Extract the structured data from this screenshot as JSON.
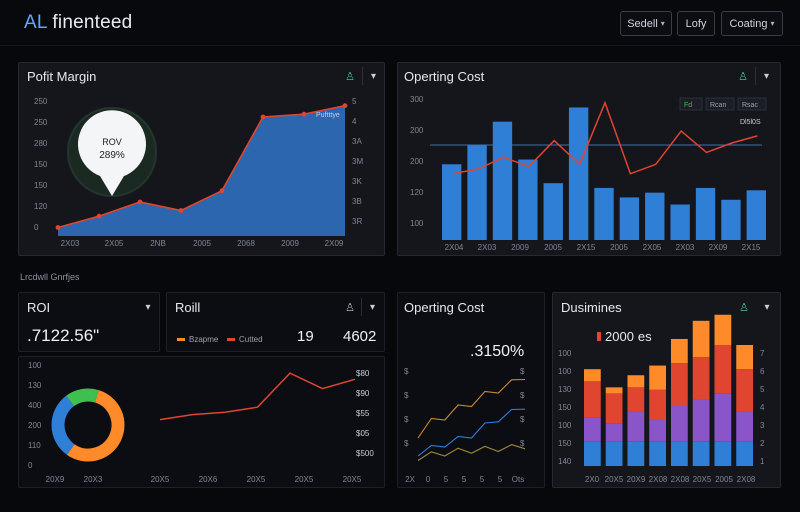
{
  "app": {
    "title_prefix": "AL",
    "title_rest": " finenteed"
  },
  "toolbar": {
    "btn1": "Sedell",
    "btn2": "Lofy",
    "btn3": "Coating"
  },
  "colors": {
    "background": "#07080c",
    "panel": "#15161c",
    "blue": "#2f7fd6",
    "red": "#e0452f",
    "orange": "#ff8a2a",
    "green": "#3fbf4f",
    "purple": "#8a55c8",
    "teal": "#3fbf8a"
  },
  "section_label": "Lrcdwll Gnrfjes",
  "profit_panel": {
    "title": "Pofit Margin",
    "tooltip_label": "ROV",
    "tooltip_value": "289%",
    "series_label": "Puftttye",
    "left_ticks": [
      "250",
      "250",
      "280",
      "150",
      "150",
      "120",
      "0"
    ],
    "right_ticks": [
      "5",
      "4",
      "3A",
      "3M",
      "3K",
      "3B",
      "3R"
    ],
    "x_ticks": [
      "2X03",
      "2X05",
      "2NB",
      "2005",
      "2068",
      "2009",
      "2X09"
    ]
  },
  "operating_panel": {
    "title": "Operting Cost",
    "legend": [
      "Fd",
      "Rcan",
      "Rsac"
    ],
    "line_label": "Dl5l0S",
    "left_ticks": [
      "300",
      "200",
      "200",
      "120",
      "100"
    ],
    "x_ticks": [
      "2X04",
      "2X03",
      "2009",
      "2005",
      "2X15",
      "2005",
      "2X05",
      "2X03",
      "2X09",
      "2X15"
    ]
  },
  "roi_panel": {
    "title": "ROI",
    "value": ".7122.56\"",
    "left_ticks": [
      "100",
      "130",
      "400",
      "200",
      "110",
      "0"
    ],
    "x_ticks": [
      "20X9",
      "20X3"
    ]
  },
  "roll_panel": {
    "title": "Roill",
    "legend": [
      "Bzapme",
      "Cutted"
    ],
    "values": [
      "19",
      "4602"
    ],
    "right_ticks": [
      "$80",
      "$90",
      "$55",
      "$05",
      "$500"
    ],
    "x_ticks": [
      "20X5",
      "20X6",
      "20X5",
      "20X5",
      "20X5"
    ]
  },
  "op_cost_small": {
    "title": "Operting Cost",
    "value": ".3150%",
    "left_ticks": [
      "$",
      "$",
      "$",
      "$"
    ],
    "right_ticks": [
      "$",
      "$",
      "$",
      "$"
    ],
    "x_ticks": [
      "2X",
      "0",
      "5",
      "5",
      "5",
      "5",
      "Ots"
    ]
  },
  "business_panel": {
    "title": "Dusimines",
    "legend_value": "2000",
    "legend_suffix": "es",
    "left_ticks": [
      "100",
      "100",
      "130",
      "150",
      "100",
      "150",
      "140"
    ],
    "right_ticks": [
      "7",
      "6",
      "5",
      "4",
      "3",
      "2",
      "1"
    ],
    "x_ticks": [
      "2X0",
      "20X5",
      "20X9",
      "2X08",
      "2X08",
      "20X5",
      "2005",
      "2X08"
    ]
  },
  "chart_data": [
    {
      "type": "area",
      "title": "Pofit Margin",
      "x": [
        "2X03",
        "2X05",
        "2NB",
        "2005",
        "2068",
        "2009",
        "2X09"
      ],
      "series": [
        {
          "name": "Puftttye",
          "values": [
            15,
            35,
            60,
            45,
            80,
            210,
            215,
            230
          ]
        }
      ]
    },
    {
      "type": "bar",
      "title": "Operting Cost",
      "series": [
        {
          "values": [
            160,
            200,
            250,
            170,
            120,
            280,
            110,
            90,
            100,
            75,
            110,
            85,
            105
          ]
        },
        {
          "values": [
            140,
            150,
            175,
            155,
            210,
            160,
            290,
            140,
            160,
            230,
            185,
            205,
            220
          ]
        }
      ]
    },
    {
      "type": "pie",
      "title": "ROI",
      "slices": [
        {
          "value": 55
        },
        {
          "value": 30
        },
        {
          "value": 15
        }
      ]
    },
    {
      "type": "line",
      "title": "Roill",
      "series": [
        {
          "values": [
            20,
            28,
            32,
            40,
            95,
            70,
            85
          ]
        }
      ]
    },
    {
      "type": "line",
      "title": "Operting Cost",
      "series": [
        {
          "values": [
            30,
            45,
            50,
            60,
            65,
            75,
            80,
            88,
            95
          ]
        },
        {
          "values": [
            10,
            15,
            20,
            25,
            30,
            40,
            48,
            55,
            62
          ]
        },
        {
          "values": [
            5,
            8,
            10,
            12,
            13,
            14,
            15,
            16,
            18
          ]
        }
      ]
    },
    {
      "type": "bar",
      "title": "Dusimines",
      "series": [
        {
          "values": [
            20,
            20,
            20,
            20,
            20,
            20,
            20,
            20
          ]
        },
        {
          "values": [
            20,
            15,
            25,
            18,
            30,
            35,
            40,
            25
          ]
        },
        {
          "values": [
            30,
            25,
            20,
            25,
            35,
            35,
            40,
            35
          ]
        },
        {
          "values": [
            10,
            5,
            10,
            20,
            20,
            30,
            25,
            20
          ]
        }
      ]
    }
  ]
}
